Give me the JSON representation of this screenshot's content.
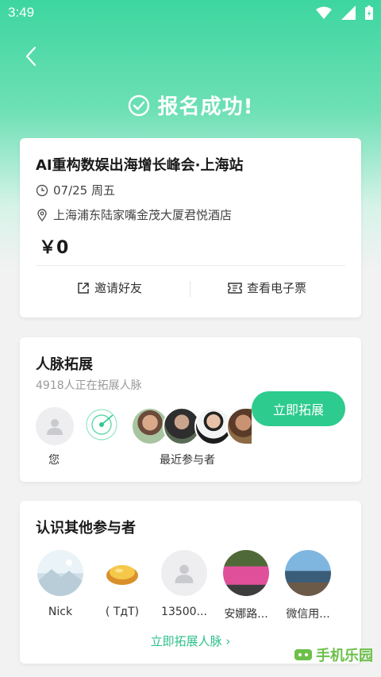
{
  "status_bar": {
    "time": "3:49"
  },
  "header": {
    "success_text": "报名成功!"
  },
  "event": {
    "title": "AI重构数娱出海增长峰会·上海站",
    "date": "07/25 周五",
    "location": "上海浦东陆家嘴金茂大厦君悦酒店",
    "price": "￥0",
    "invite_label": "邀请好友",
    "ticket_label": "查看电子票"
  },
  "network": {
    "title": "人脉拓展",
    "subtitle": "4918人正在拓展人脉",
    "me_label": "您",
    "recent_label": "最近参与者",
    "expand_button": "立即拓展"
  },
  "others": {
    "title": "认识其他参与者",
    "people": [
      {
        "name": "Nick"
      },
      {
        "name": "( TдT)"
      },
      {
        "name": "13500..."
      },
      {
        "name": "安娜路..."
      },
      {
        "name": "微信用..."
      }
    ],
    "more_link": "立即拓展人脉 ›"
  },
  "watermark": {
    "text": "手机乐园"
  },
  "colors": {
    "accent": "#2dcb8e",
    "gradient_top": "#3dd6a0",
    "background": "#f2f2f2"
  }
}
